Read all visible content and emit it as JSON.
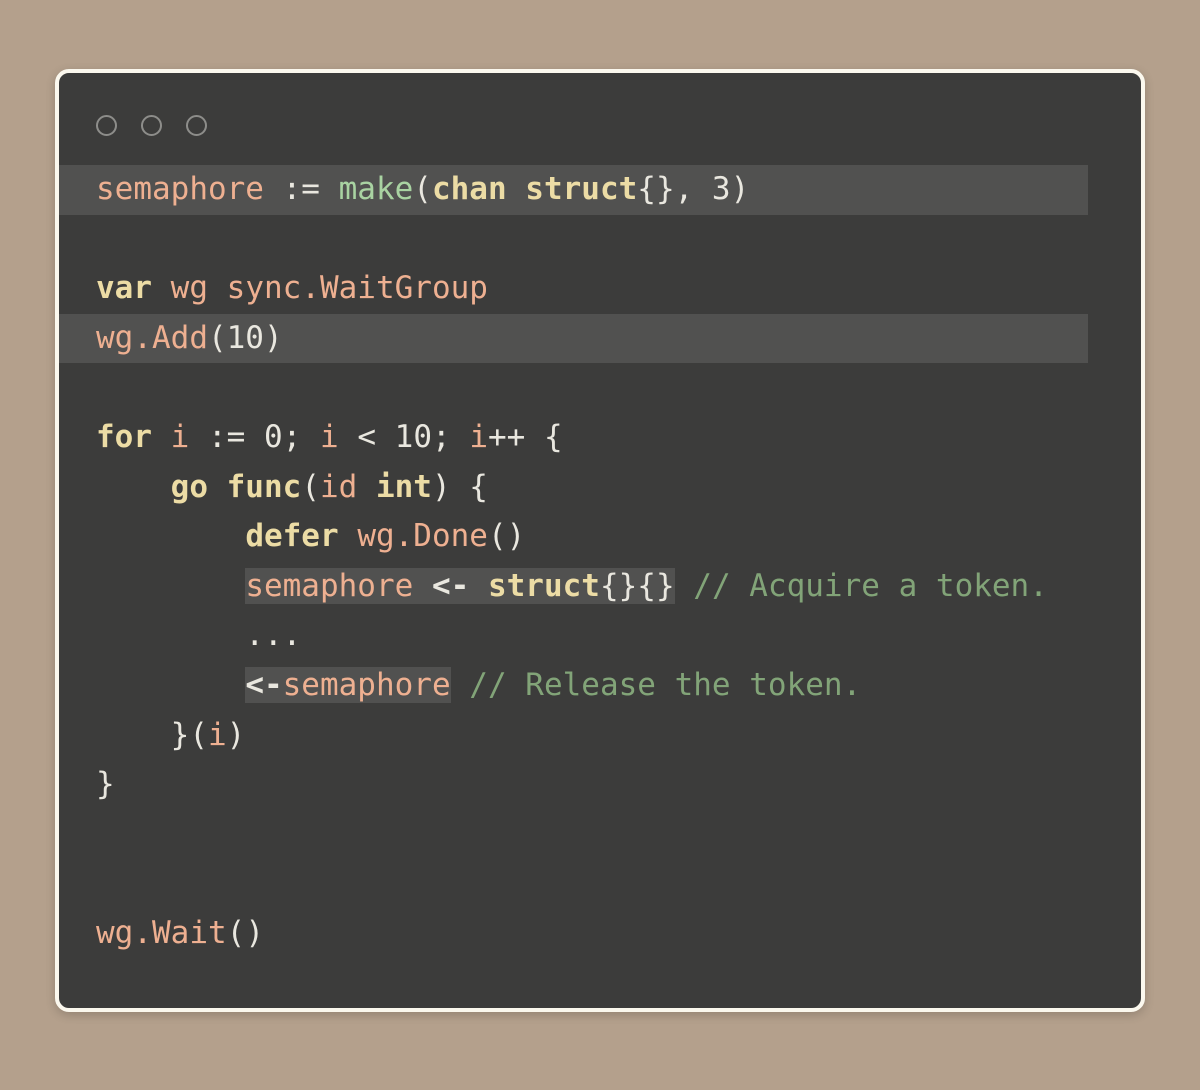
{
  "window": {
    "title": "",
    "background_color": "#b4a08c",
    "window_bg": "#3c3c3b",
    "border_color": "#fbf8ee",
    "highlight_color": "#515150",
    "traffic_lights": [
      {
        "name": "close",
        "label": ""
      },
      {
        "name": "minimize",
        "label": ""
      },
      {
        "name": "maximize",
        "label": ""
      }
    ]
  },
  "theme": {
    "keyword": "#ecdca5",
    "identifier": "#eeb091",
    "function": "#a9d3a2",
    "comment": "#82a478",
    "plain": "#e9e7df"
  },
  "code": {
    "language": "go",
    "lines": [
      {
        "n": 1,
        "highlight": "full",
        "tokens": [
          {
            "t": "semaphore",
            "c": "ident"
          },
          {
            "t": " := ",
            "c": "plain"
          },
          {
            "t": "make",
            "c": "fn"
          },
          {
            "t": "(",
            "c": "plain"
          },
          {
            "t": "chan struct",
            "c": "kw"
          },
          {
            "t": "{}, 3)",
            "c": "plain"
          }
        ]
      },
      {
        "n": 2,
        "highlight": "none",
        "tokens": []
      },
      {
        "n": 3,
        "highlight": "none",
        "tokens": [
          {
            "t": "var",
            "c": "kw"
          },
          {
            "t": " ",
            "c": "plain"
          },
          {
            "t": "wg sync.WaitGroup",
            "c": "ident"
          }
        ]
      },
      {
        "n": 4,
        "highlight": "full",
        "tokens": [
          {
            "t": "wg.Add",
            "c": "ident"
          },
          {
            "t": "(10)",
            "c": "plain"
          }
        ]
      },
      {
        "n": 5,
        "highlight": "none",
        "tokens": []
      },
      {
        "n": 6,
        "highlight": "none",
        "tokens": [
          {
            "t": "for",
            "c": "kw"
          },
          {
            "t": " ",
            "c": "plain"
          },
          {
            "t": "i",
            "c": "ident"
          },
          {
            "t": " := 0; ",
            "c": "plain"
          },
          {
            "t": "i",
            "c": "ident"
          },
          {
            "t": " < 10; ",
            "c": "plain"
          },
          {
            "t": "i",
            "c": "ident"
          },
          {
            "t": "++ {",
            "c": "plain"
          }
        ]
      },
      {
        "n": 7,
        "highlight": "none",
        "tokens": [
          {
            "t": "    ",
            "c": "plain"
          },
          {
            "t": "go func",
            "c": "kw"
          },
          {
            "t": "(",
            "c": "plain"
          },
          {
            "t": "id",
            "c": "ident"
          },
          {
            "t": " ",
            "c": "plain"
          },
          {
            "t": "int",
            "c": "kw"
          },
          {
            "t": ") {",
            "c": "plain"
          }
        ]
      },
      {
        "n": 8,
        "highlight": "none",
        "tokens": [
          {
            "t": "        ",
            "c": "plain"
          },
          {
            "t": "defer",
            "c": "kw"
          },
          {
            "t": " ",
            "c": "plain"
          },
          {
            "t": "wg.Done",
            "c": "ident"
          },
          {
            "t": "()",
            "c": "plain"
          }
        ]
      },
      {
        "n": 9,
        "highlight": "inline",
        "highlight_start_col": 8,
        "highlight_end_col": 29,
        "tokens": [
          {
            "t": "        ",
            "c": "plain"
          },
          {
            "t": "semaphore",
            "c": "ident",
            "hl": true
          },
          {
            "t": " ",
            "c": "plain",
            "hl": true
          },
          {
            "t": "<-",
            "c": "op",
            "hl": true
          },
          {
            "t": " ",
            "c": "plain",
            "hl": true
          },
          {
            "t": "struct",
            "c": "kw",
            "hl": true
          },
          {
            "t": "{}{}",
            "c": "plain",
            "hl": true
          },
          {
            "t": " ",
            "c": "plain"
          },
          {
            "t": "// Acquire a token.",
            "c": "comment"
          }
        ]
      },
      {
        "n": 10,
        "highlight": "none",
        "tokens": [
          {
            "t": "        ",
            "c": "plain"
          },
          {
            "t": "...",
            "c": "dots"
          }
        ]
      },
      {
        "n": 11,
        "highlight": "inline",
        "highlight_start_col": 8,
        "highlight_end_col": 19,
        "tokens": [
          {
            "t": "        ",
            "c": "plain"
          },
          {
            "t": "<-",
            "c": "op",
            "hl": true
          },
          {
            "t": "semaphore",
            "c": "ident",
            "hl": true
          },
          {
            "t": " ",
            "c": "plain"
          },
          {
            "t": "// Release the token.",
            "c": "comment"
          }
        ]
      },
      {
        "n": 12,
        "highlight": "none",
        "tokens": [
          {
            "t": "    }(",
            "c": "plain"
          },
          {
            "t": "i",
            "c": "ident"
          },
          {
            "t": ")",
            "c": "plain"
          }
        ]
      },
      {
        "n": 13,
        "highlight": "none",
        "tokens": [
          {
            "t": "}",
            "c": "plain"
          }
        ]
      },
      {
        "n": 14,
        "highlight": "none",
        "tokens": []
      },
      {
        "n": 15,
        "highlight": "none",
        "tokens": []
      },
      {
        "n": 16,
        "highlight": "none",
        "tokens": [
          {
            "t": "wg.Wait",
            "c": "ident"
          },
          {
            "t": "()",
            "c": "plain"
          }
        ]
      }
    ]
  }
}
